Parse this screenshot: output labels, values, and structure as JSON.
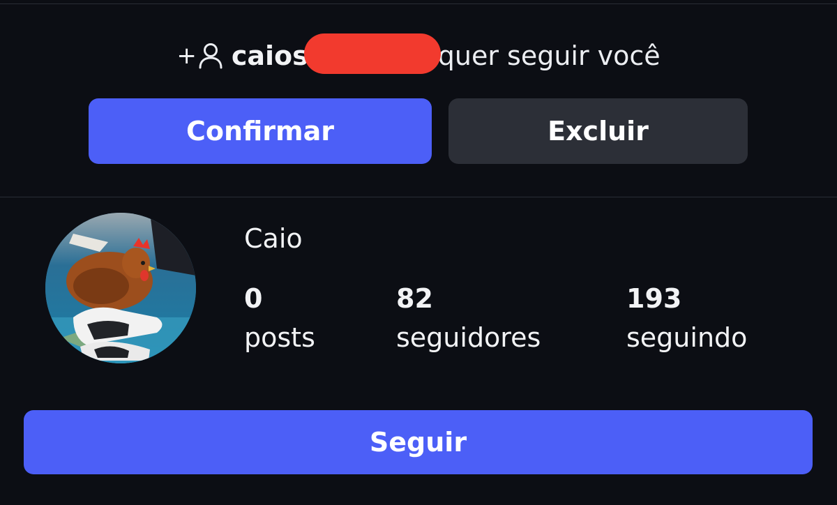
{
  "request": {
    "username_visible": "caios",
    "text": "quer seguir você",
    "add_prefix": "+"
  },
  "actions": {
    "confirm_label": "Confirmar",
    "delete_label": "Excluir"
  },
  "profile": {
    "name": "Caio",
    "stats": [
      {
        "value": "0",
        "label": "posts"
      },
      {
        "value": "82",
        "label": "seguidores"
      },
      {
        "value": "193",
        "label": "seguindo"
      }
    ]
  },
  "follow_label": "Seguir",
  "colors": {
    "background": "#0c0e14",
    "accent": "#4c5ff7",
    "secondary_button": "#2c2f37",
    "redaction": "#f23a2e"
  },
  "icons": {
    "request": "add-person-icon"
  }
}
